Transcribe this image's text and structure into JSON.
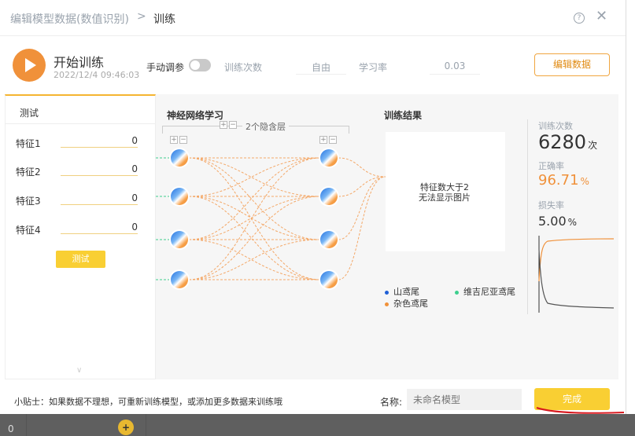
{
  "header": {
    "breadcrumb_parent": "编辑模型数据(数值识别)",
    "breadcrumb_separator": ">",
    "breadcrumb_current": "训练",
    "help_icon": "?",
    "close_icon": "✕"
  },
  "toolbar": {
    "start_label": "开始训练",
    "start_time": "2022/12/4 09:46:03",
    "manual_label": "手动调参",
    "iterations_label": "训练次数",
    "iterations_value": "自由",
    "lr_label": "学习率",
    "lr_value": "0.03",
    "edit_button": "编辑数据"
  },
  "test_panel": {
    "title": "测试",
    "features": [
      {
        "label": "特征1",
        "value": "0"
      },
      {
        "label": "特征2",
        "value": "0"
      },
      {
        "label": "特征3",
        "value": "0"
      },
      {
        "label": "特征4",
        "value": "0"
      }
    ],
    "test_button": "测试"
  },
  "network": {
    "title": "神经网络学习",
    "hidden_layers_label": "2个隐含层",
    "plus": "+",
    "minus": "−"
  },
  "results": {
    "title": "训练结果",
    "message_line1": "特征数大于2",
    "message_line2": "无法显示图片",
    "legend": [
      {
        "label": "山鸢尾",
        "color": "#1f5fd6"
      },
      {
        "label": "维吉尼亚鸢尾",
        "color": "#3ecf8e"
      },
      {
        "label": "杂色鸢尾",
        "color": "#f0913a"
      }
    ]
  },
  "stats": {
    "count_label": "训练次数",
    "count_value": "6280",
    "count_unit": "次",
    "accuracy_label": "正确率",
    "accuracy_value": "96.71",
    "accuracy_unit": "%",
    "loss_label": "损失率",
    "loss_value": "5.00",
    "loss_unit": "%"
  },
  "footer": {
    "tip": "小贴士：如果数据不理想，可重新训练模型，或添加更多数据来训练哦",
    "name_label": "名称:",
    "name_placeholder": "未命名模型",
    "done_button": "完成"
  },
  "background": {
    "zero": "0",
    "plus": "+"
  },
  "colors": {
    "accent": "#f0913a",
    "button_yellow": "#f9cf33",
    "muted": "#9aa3ad"
  }
}
